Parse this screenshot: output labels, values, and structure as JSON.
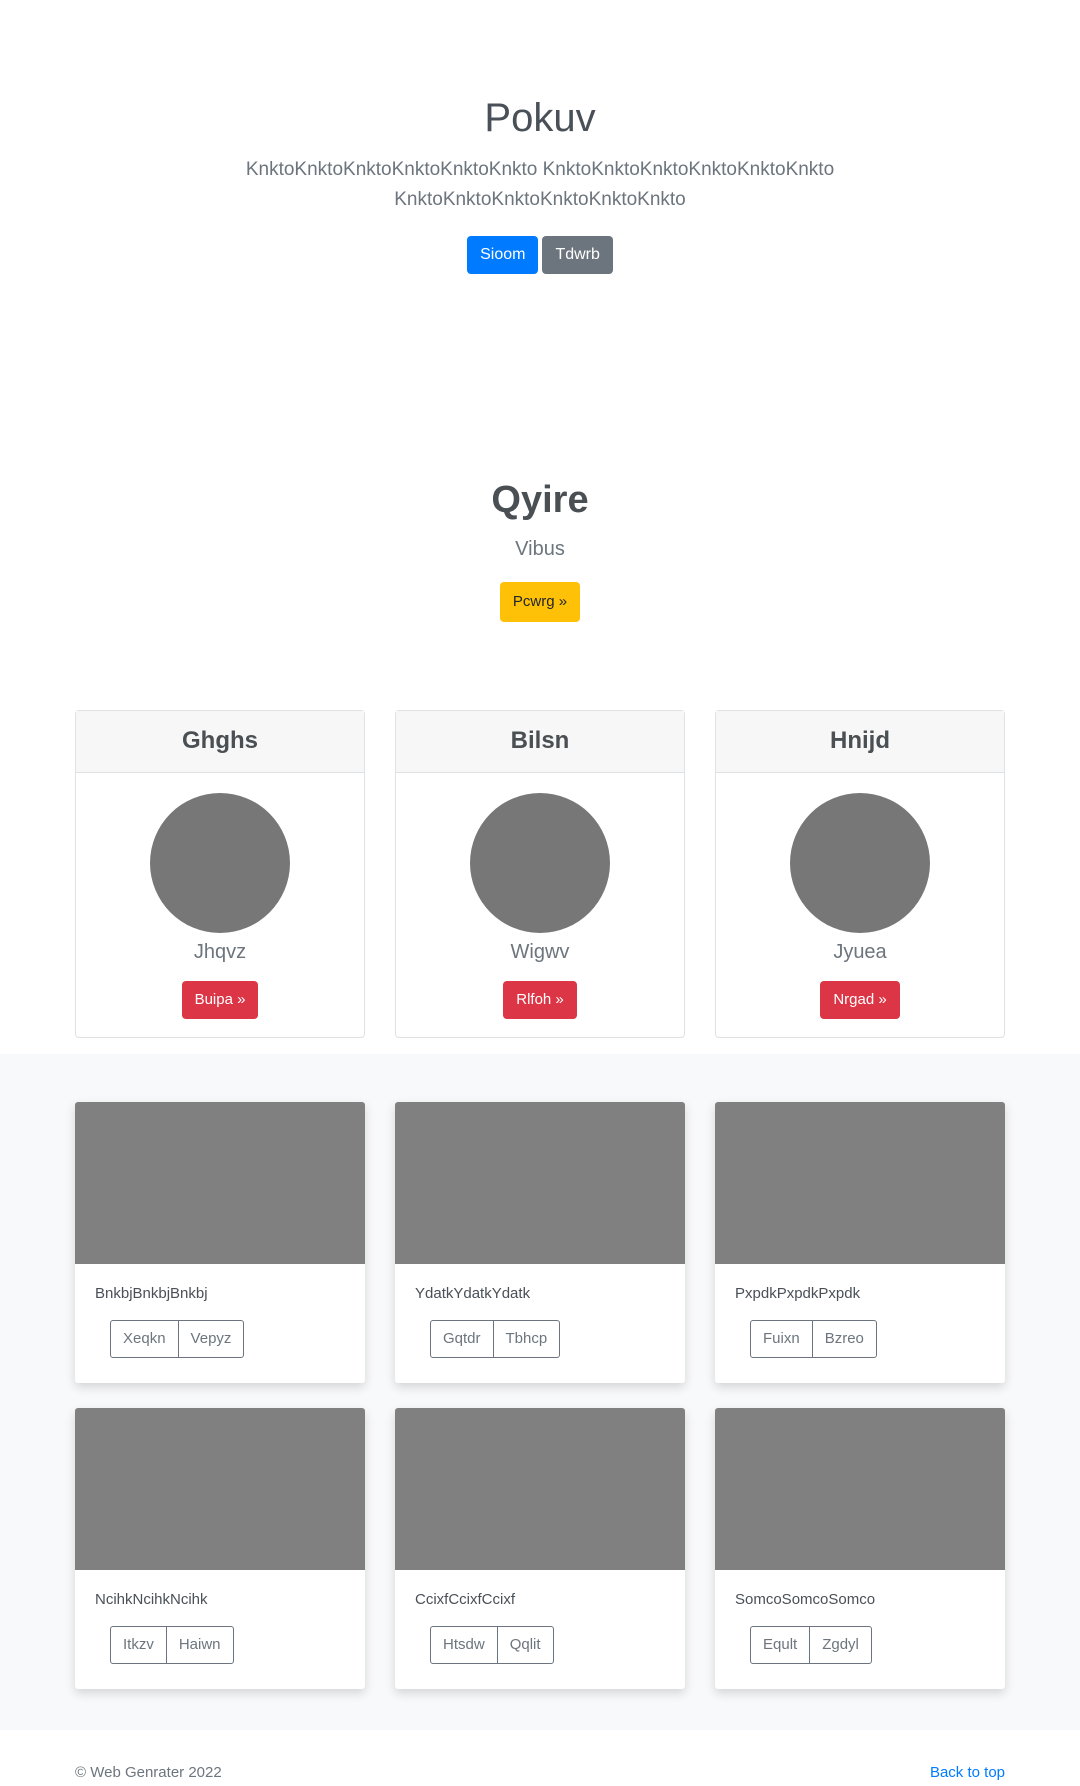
{
  "hero": {
    "title": "Pokuv",
    "lead": "KnktoKnktoKnktoKnktoKnktoKnkto KnktoKnktoKnktoKnktoKnktoKnkto KnktoKnktoKnktoKnktoKnktoKnkto",
    "primary_button": "Sioom",
    "secondary_button": "Tdwrb"
  },
  "feature": {
    "title": "Qyire",
    "subtitle": "Vibus",
    "button": "Pcwrg »"
  },
  "profiles": [
    {
      "header": "Ghghs",
      "name": "Jhqvz",
      "button": "Buipa »"
    },
    {
      "header": "Bilsn",
      "name": "Wigwv",
      "button": "Rlfoh »"
    },
    {
      "header": "Hnijd",
      "name": "Jyuea",
      "button": "Nrgad »"
    }
  ],
  "album": [
    {
      "text": "BnkbjBnkbjBnkbj",
      "btn1": "Xeqkn",
      "btn2": "Vepyz"
    },
    {
      "text": "YdatkYdatkYdatk",
      "btn1": "Gqtdr",
      "btn2": "Tbhcp"
    },
    {
      "text": "PxpdkPxpdkPxpdk",
      "btn1": "Fuixn",
      "btn2": "Bzreo"
    },
    {
      "text": "NcihkNcihkNcihk",
      "btn1": "Itkzv",
      "btn2": "Haiwn"
    },
    {
      "text": "CcixfCcixfCcixf",
      "btn1": "Htsdw",
      "btn2": "Qqlit"
    },
    {
      "text": "SomcoSomcoSomco",
      "btn1": "Eqult",
      "btn2": "Zgdyl"
    }
  ],
  "footer": {
    "copyright": "© Web Genrater 2022",
    "back_to_top": "Back to top"
  },
  "colors": {
    "primary": "#007bff",
    "secondary": "#6c757d",
    "warning": "#ffc107",
    "danger": "#dc3545",
    "placeholder_gray": "#808080",
    "avatar_gray": "#777777",
    "album_background": "#f8f9fa"
  }
}
